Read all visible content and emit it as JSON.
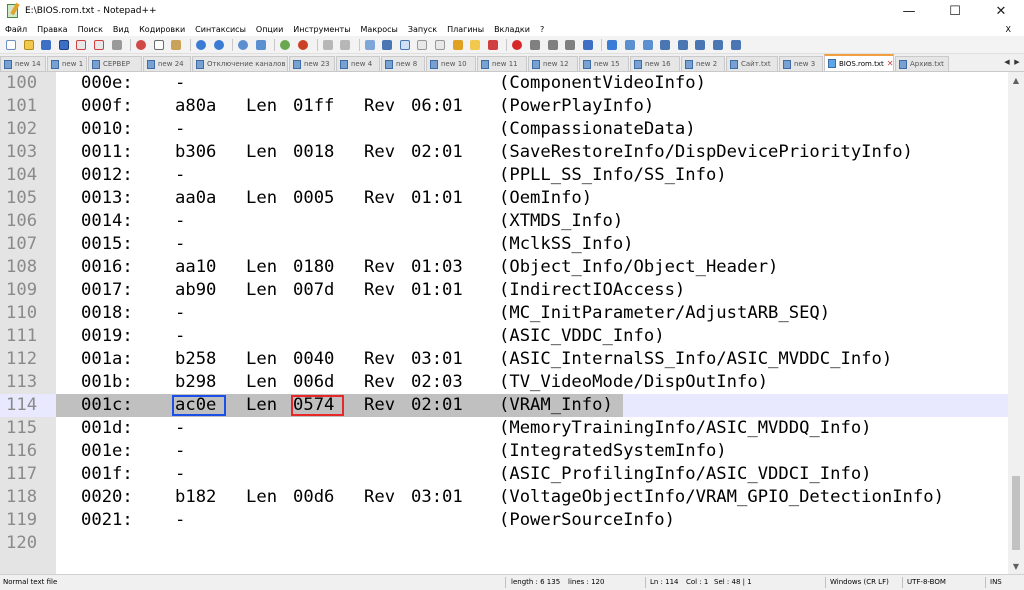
{
  "window": {
    "title": "E:\\BIOS.rom.txt - Notepad++",
    "minimize": "—",
    "maximize": "☐",
    "close": "✕"
  },
  "menu": [
    "Файл",
    "Правка",
    "Поиск",
    "Вид",
    "Кодировки",
    "Синтаксисы",
    "Опции",
    "Инструменты",
    "Макросы",
    "Запуск",
    "Плагины",
    "Вкладки",
    "?"
  ],
  "menu_close": "X",
  "tabs": [
    {
      "label": "new 14",
      "active": false
    },
    {
      "label": "new 1",
      "active": false
    },
    {
      "label": "СЕРВЕР",
      "active": false
    },
    {
      "label": "new 24",
      "active": false
    },
    {
      "label": "Отключение каналов",
      "active": false
    },
    {
      "label": "new 23",
      "active": false
    },
    {
      "label": "new 4",
      "active": false
    },
    {
      "label": "new 8",
      "active": false
    },
    {
      "label": "new 10",
      "active": false
    },
    {
      "label": "new 11",
      "active": false
    },
    {
      "label": "new 12",
      "active": false
    },
    {
      "label": "new 15",
      "active": false
    },
    {
      "label": "new 16",
      "active": false
    },
    {
      "label": "new 2",
      "active": false
    },
    {
      "label": "Сайт.txt",
      "active": false
    },
    {
      "label": "new 3",
      "active": false
    },
    {
      "label": "BIOS.rom.txt",
      "active": true
    },
    {
      "label": "Архив.txt",
      "active": false
    }
  ],
  "editor": {
    "current_line": 114,
    "lines": [
      {
        "n": "100",
        "id": "000e:",
        "addr": "-",
        "len_label": "",
        "len": "",
        "rev_label": "",
        "rev": "",
        "name": "(ComponentVideoInfo)"
      },
      {
        "n": "101",
        "id": "000f:",
        "addr": "a80a",
        "len_label": "Len",
        "len": "01ff",
        "rev_label": "Rev",
        "rev": "06:01",
        "name": "(PowerPlayInfo)"
      },
      {
        "n": "102",
        "id": "0010:",
        "addr": "-",
        "len_label": "",
        "len": "",
        "rev_label": "",
        "rev": "",
        "name": "(CompassionateData)"
      },
      {
        "n": "103",
        "id": "0011:",
        "addr": "b306",
        "len_label": "Len",
        "len": "0018",
        "rev_label": "Rev",
        "rev": "02:01",
        "name": "(SaveRestoreInfo/DispDevicePriorityInfo)"
      },
      {
        "n": "104",
        "id": "0012:",
        "addr": "-",
        "len_label": "",
        "len": "",
        "rev_label": "",
        "rev": "",
        "name": "(PPLL_SS_Info/SS_Info)"
      },
      {
        "n": "105",
        "id": "0013:",
        "addr": "aa0a",
        "len_label": "Len",
        "len": "0005",
        "rev_label": "Rev",
        "rev": "01:01",
        "name": "(OemInfo)"
      },
      {
        "n": "106",
        "id": "0014:",
        "addr": "-",
        "len_label": "",
        "len": "",
        "rev_label": "",
        "rev": "",
        "name": "(XTMDS_Info)"
      },
      {
        "n": "107",
        "id": "0015:",
        "addr": "-",
        "len_label": "",
        "len": "",
        "rev_label": "",
        "rev": "",
        "name": "(MclkSS_Info)"
      },
      {
        "n": "108",
        "id": "0016:",
        "addr": "aa10",
        "len_label": "Len",
        "len": "0180",
        "rev_label": "Rev",
        "rev": "01:03",
        "name": "(Object_Info/Object_Header)"
      },
      {
        "n": "109",
        "id": "0017:",
        "addr": "ab90",
        "len_label": "Len",
        "len": "007d",
        "rev_label": "Rev",
        "rev": "01:01",
        "name": "(IndirectIOAccess)"
      },
      {
        "n": "110",
        "id": "0018:",
        "addr": "-",
        "len_label": "",
        "len": "",
        "rev_label": "",
        "rev": "",
        "name": "(MC_InitParameter/AdjustARB_SEQ)"
      },
      {
        "n": "111",
        "id": "0019:",
        "addr": "-",
        "len_label": "",
        "len": "",
        "rev_label": "",
        "rev": "",
        "name": "(ASIC_VDDC_Info)"
      },
      {
        "n": "112",
        "id": "001a:",
        "addr": "b258",
        "len_label": "Len",
        "len": "0040",
        "rev_label": "Rev",
        "rev": "03:01",
        "name": "(ASIC_InternalSS_Info/ASIC_MVDDC_Info)"
      },
      {
        "n": "113",
        "id": "001b:",
        "addr": "b298",
        "len_label": "Len",
        "len": "006d",
        "rev_label": "Rev",
        "rev": "02:03",
        "name": "(TV_VideoMode/DispOutInfo)"
      },
      {
        "n": "114",
        "id": "001c:",
        "addr": "ac0e",
        "len_label": "Len",
        "len": "0574",
        "rev_label": "Rev",
        "rev": "02:01",
        "name": "(VRAM_Info)"
      },
      {
        "n": "115",
        "id": "001d:",
        "addr": "-",
        "len_label": "",
        "len": "",
        "rev_label": "",
        "rev": "",
        "name": "(MemoryTrainingInfo/ASIC_MVDDQ_Info)"
      },
      {
        "n": "116",
        "id": "001e:",
        "addr": "-",
        "len_label": "",
        "len": "",
        "rev_label": "",
        "rev": "",
        "name": "(IntegratedSystemInfo)"
      },
      {
        "n": "117",
        "id": "001f:",
        "addr": "-",
        "len_label": "",
        "len": "",
        "rev_label": "",
        "rev": "",
        "name": "(ASIC_ProfilingInfo/ASIC_VDDCI_Info)"
      },
      {
        "n": "118",
        "id": "0020:",
        "addr": "b182",
        "len_label": "Len",
        "len": "00d6",
        "rev_label": "Rev",
        "rev": "03:01",
        "name": "(VoltageObjectInfo/VRAM_GPIO_DetectionInfo)"
      },
      {
        "n": "119",
        "id": "0021:",
        "addr": "-",
        "len_label": "",
        "len": "",
        "rev_label": "",
        "rev": "",
        "name": "(PowerSourceInfo)"
      },
      {
        "n": "120",
        "id": "",
        "addr": "",
        "len_label": "",
        "len": "",
        "rev_label": "",
        "rev": "",
        "name": ""
      }
    ]
  },
  "status": {
    "file_type": "Normal text file",
    "length": "length : 6 135",
    "lines": "lines : 120",
    "ln": "Ln : 114",
    "col": "Col : 1",
    "sel": "Sel : 48 | 1",
    "eol": "Windows (CR LF)",
    "encoding": "UTF-8-BOM",
    "mode": "INS"
  },
  "colors": {
    "current_line_bg": "#e8e8ff",
    "selection_bg": "#c0c0c0",
    "box_blue": "#1c4ee8",
    "box_red": "#e82828",
    "active_tab_accent": "#f0a040"
  }
}
